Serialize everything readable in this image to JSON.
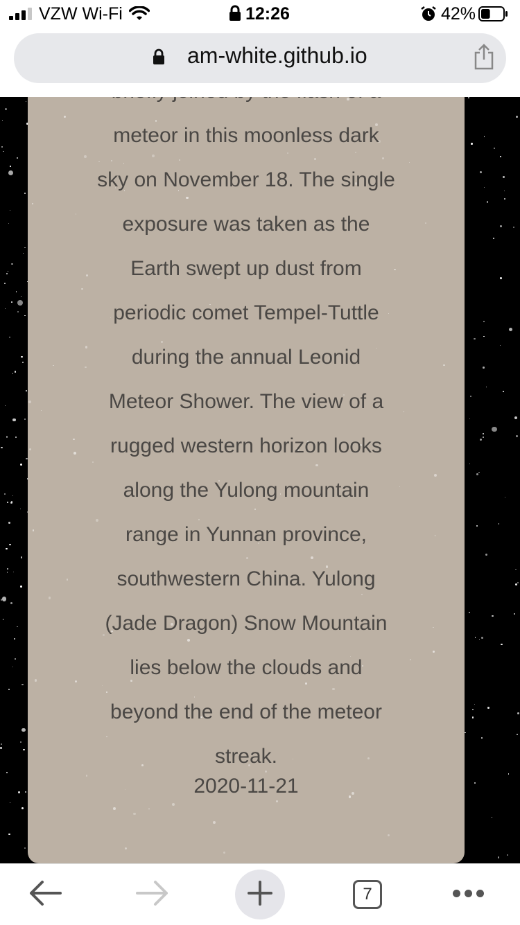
{
  "status_bar": {
    "carrier": "VZW Wi-Fi",
    "time": "12:26",
    "battery_percent": "42%",
    "battery_level": 0.42,
    "icons": [
      "signal-icon",
      "wifi-icon",
      "lock-icon",
      "alarm-icon",
      "battery-icon"
    ]
  },
  "url_bar": {
    "url": "am-white.github.io",
    "icons": [
      "lock-icon",
      "share-icon"
    ]
  },
  "article": {
    "lines": [
      "briefly joined by the flash of a",
      "meteor in this moonless dark",
      "sky on November 18. The single",
      "exposure was taken as the",
      "Earth swept up dust from",
      "periodic comet Tempel-Tuttle",
      "during the annual Leonid",
      "Meteor Shower. The view of a",
      "rugged western horizon looks",
      "along the Yulong mountain",
      "range in Yunnan province,",
      "southwestern China. Yulong",
      "(Jade Dragon) Snow Mountain",
      "lies below the clouds and",
      "beyond the end of the meteor",
      "streak."
    ],
    "date": "2020-11-21"
  },
  "toolbar": {
    "tab_count": "7",
    "icons": [
      "back-arrow-icon",
      "forward-arrow-icon",
      "plus-icon",
      "tabs-icon",
      "more-icon"
    ]
  },
  "colors": {
    "card_background": "#bcb1a4",
    "card_text": "#4a4744",
    "page_background": "#000000",
    "url_pill": "#e7e8eb"
  }
}
